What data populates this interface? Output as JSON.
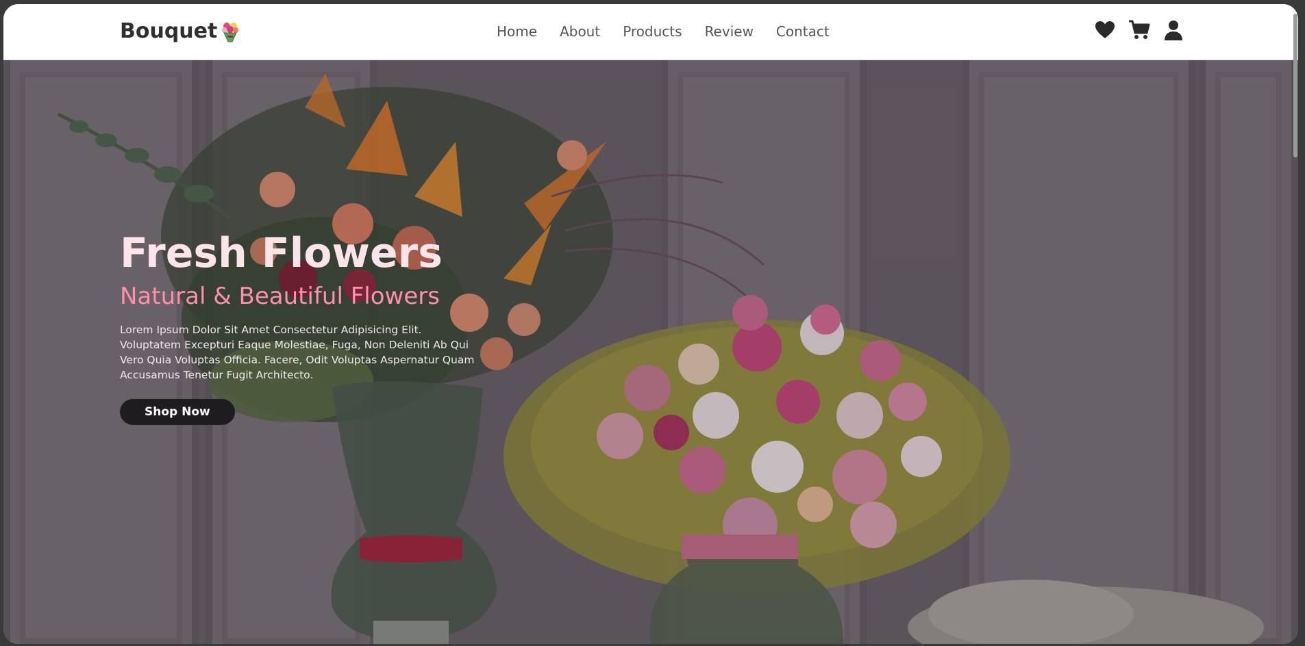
{
  "header": {
    "logo_text": "Bouquet",
    "nav": [
      "Home",
      "About",
      "Products",
      "Review",
      "Contact"
    ]
  },
  "icons": {
    "logo": "bouquet-icon",
    "wishlist": "heart-icon",
    "cart": "cart-icon",
    "account": "user-icon"
  },
  "hero": {
    "title": "Fresh Flowers",
    "subtitle": "Natural & Beautiful Flowers",
    "description": "Lorem Ipsum Dolor Sit Amet Consectetur Adipisicing Elit. Voluptatem Excepturi Eaque Molestiae, Fuga, Non Deleniti Ab Qui Vero Quia Voluptas Officia. Facere, Odit Voluptas Aspernatur Quam Accusamus Tenetur Fugit Architecto.",
    "button_label": "Shop Now"
  },
  "colors": {
    "title": "#fde3ea",
    "accent": "#ff8fab",
    "button": "#1f1c20"
  }
}
